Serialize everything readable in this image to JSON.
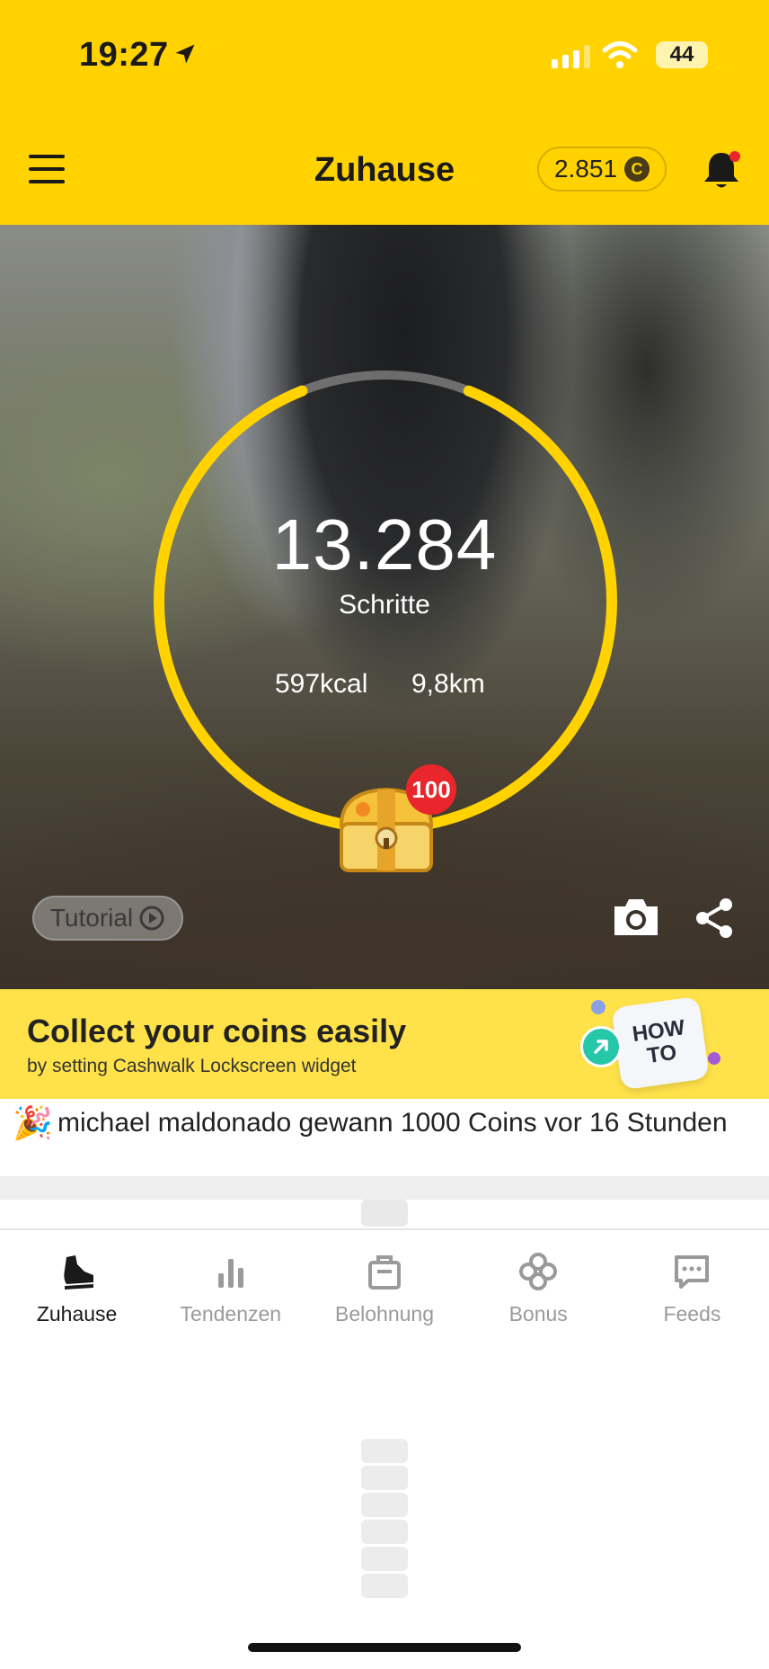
{
  "status_bar": {
    "time": "19:27",
    "battery": "44"
  },
  "header": {
    "title": "Zuhause",
    "coins": "2.851",
    "coin_symbol": "C"
  },
  "hero": {
    "steps": "13.284",
    "steps_label": "Schritte",
    "kcal": "597kcal",
    "distance": "9,8km",
    "chest_badge": "100",
    "tutorial_label": "Tutorial",
    "ring_progress": 0.88
  },
  "banner": {
    "title": "Collect your coins easily",
    "subtitle": "by setting Cashwalk Lockscreen widget",
    "howto_line1": "HOW",
    "howto_line2": "TO"
  },
  "ticker": {
    "emoji": "🎉",
    "text": "michael maldonado gewann 1000 Coins vor 16 Stunden"
  },
  "tabs": [
    {
      "label": "Zuhause",
      "icon": "shoe-icon",
      "active": true
    },
    {
      "label": "Tendenzen",
      "icon": "bar-chart-icon",
      "active": false
    },
    {
      "label": "Belohnung",
      "icon": "shopping-bag-icon",
      "active": false
    },
    {
      "label": "Bonus",
      "icon": "clover-icon",
      "active": false
    },
    {
      "label": "Feeds",
      "icon": "chat-bubble-icon",
      "active": false
    }
  ],
  "colors": {
    "accent": "#ffd200",
    "badge": "#e8262b",
    "howto_arrow": "#26c6a8"
  }
}
